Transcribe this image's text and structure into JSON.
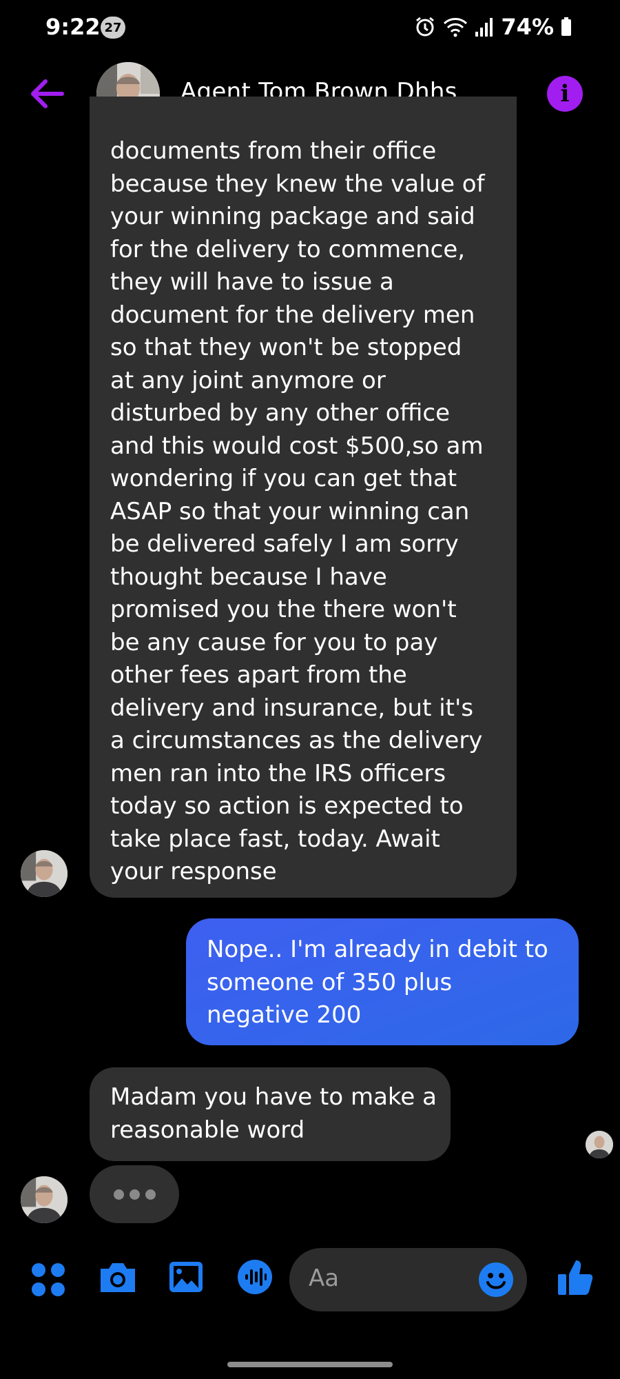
{
  "status_bar": {
    "time": "9:22",
    "notification_count": "27",
    "battery": "74%"
  },
  "header": {
    "contact_name": "Agent Tom Brown Dhhs",
    "accent_color": "#a21ef0"
  },
  "messages": {
    "incoming_1": {
      "lines": [
        "documents from their office",
        "because they knew the value of",
        "your winning package and said",
        "for the delivery to commence,",
        "they will have to issue a",
        "document for the delivery men",
        "so that they won't be stopped",
        "at any joint anymore or",
        "disturbed by any other office",
        "and this would cost $500,so am",
        "wondering if you can get that",
        "ASAP so that your winning can",
        "be delivered safely I am sorry",
        "thought because I have",
        "promised you the there won't",
        "be any  cause for you to pay",
        "other fees apart from the",
        "delivery and insurance, but it's",
        "a circumstances as the delivery",
        "men  ran into the IRS officers",
        "today so action is expected to",
        "take place fast, today. Await",
        "your response"
      ]
    },
    "outgoing_1": {
      "lines": [
        "Nope.. I'm already in debit to",
        "someone of 350 plus",
        "negative 200"
      ]
    },
    "incoming_2": {
      "lines": [
        "Madam you have to make a",
        "reasonable word"
      ]
    }
  },
  "composer": {
    "placeholder": "Aa",
    "icons": [
      "apps-icon",
      "camera-icon",
      "gallery-icon",
      "voice-icon",
      "emoji-icon",
      "like-icon"
    ],
    "icon_color": "#1e7cf2"
  }
}
